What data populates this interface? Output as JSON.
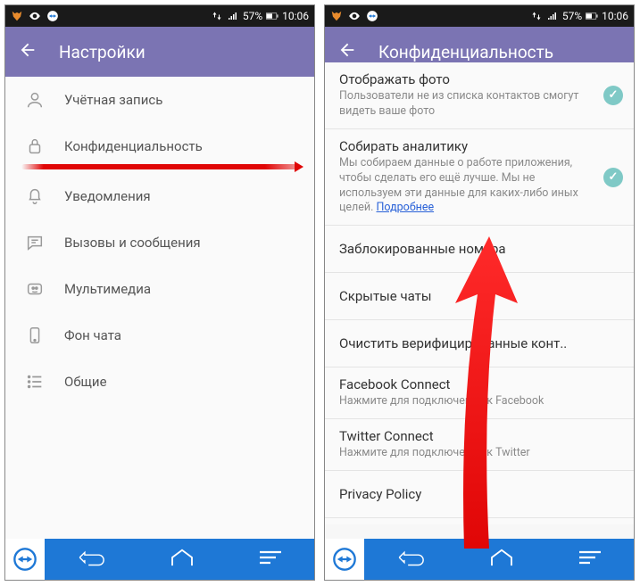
{
  "status": {
    "battery_pct": "57%",
    "time": "10:06"
  },
  "left": {
    "header_title": "Настройки",
    "items": [
      {
        "label": "Учётная запись"
      },
      {
        "label": "Конфиденциальность"
      },
      {
        "label": "Уведомления"
      },
      {
        "label": "Вызовы и сообщения"
      },
      {
        "label": "Мультимедиа"
      },
      {
        "label": "Фон чата"
      },
      {
        "label": "Общие"
      }
    ]
  },
  "right": {
    "header_title": "Конфиденциальность",
    "row_photo": {
      "title": "Отображать фото",
      "desc": "Пользователи не из списка контактов смогут видеть ваше фото"
    },
    "row_analytics": {
      "title": "Собирать аналитику",
      "desc": "Мы собираем данные о работе приложения, чтобы сделать его ещё лучше. Мы не используем эти данные для каких-либо иных целей.",
      "link": "Подробнее"
    },
    "row_blocked": {
      "title": "Заблокированные номера"
    },
    "row_hidden": {
      "title": "Скрытые чаты"
    },
    "row_clear": {
      "title": "Очистить верифицированные конт.."
    },
    "row_fb": {
      "title": "Facebook Connect",
      "desc": "Нажмите для подключения к Facebook"
    },
    "row_tw": {
      "title": "Twitter Connect",
      "desc": "Нажмите для подключения к Twitter"
    },
    "row_pp": {
      "title": "Privacy Policy"
    }
  }
}
